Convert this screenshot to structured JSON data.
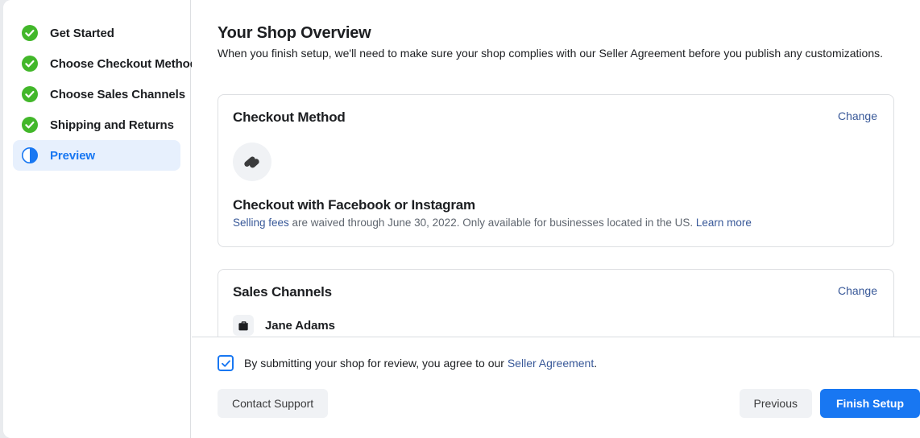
{
  "sidebar": {
    "steps": [
      {
        "label": "Get Started",
        "state": "complete",
        "icon": "check-circle-icon"
      },
      {
        "label": "Choose Checkout Method",
        "state": "complete",
        "icon": "check-circle-icon"
      },
      {
        "label": "Choose Sales Channels",
        "state": "complete",
        "icon": "check-circle-icon"
      },
      {
        "label": "Shipping and Returns",
        "state": "complete",
        "icon": "check-circle-icon"
      },
      {
        "label": "Preview",
        "state": "active",
        "icon": "half-circle-icon"
      }
    ]
  },
  "main": {
    "title": "Your Shop Overview",
    "subtitle": "When you finish setup, we'll need to make sure your shop complies with our Seller Agreement before you publish any customizations.",
    "checkout_card": {
      "title": "Checkout Method",
      "change_label": "Change",
      "icon": "meta-checkout-icon",
      "method_name": "Checkout with Facebook or Instagram",
      "desc_link_start": "Selling fees",
      "desc_middle": " are waived through June 30, 2022. Only available for businesses located in the US. ",
      "desc_link_end": "Learn more"
    },
    "sales_card": {
      "title": "Sales Channels",
      "change_label": "Change",
      "channels": [
        {
          "name": "Jane Adams",
          "icon": "briefcase-icon"
        }
      ]
    }
  },
  "footer": {
    "agree_text_start": "By submitting your shop for review, you agree to our ",
    "agree_link": "Seller Agreement",
    "agree_text_end": ".",
    "checkbox_checked": true,
    "contact_support_label": "Contact Support",
    "previous_label": "Previous",
    "finish_label": "Finish Setup"
  },
  "colors": {
    "accent_blue": "#1877f2",
    "link_blue": "#385898",
    "complete_green": "#42b72a",
    "active_highlight": "#e7f0fd",
    "button_grey": "#f0f2f5"
  }
}
